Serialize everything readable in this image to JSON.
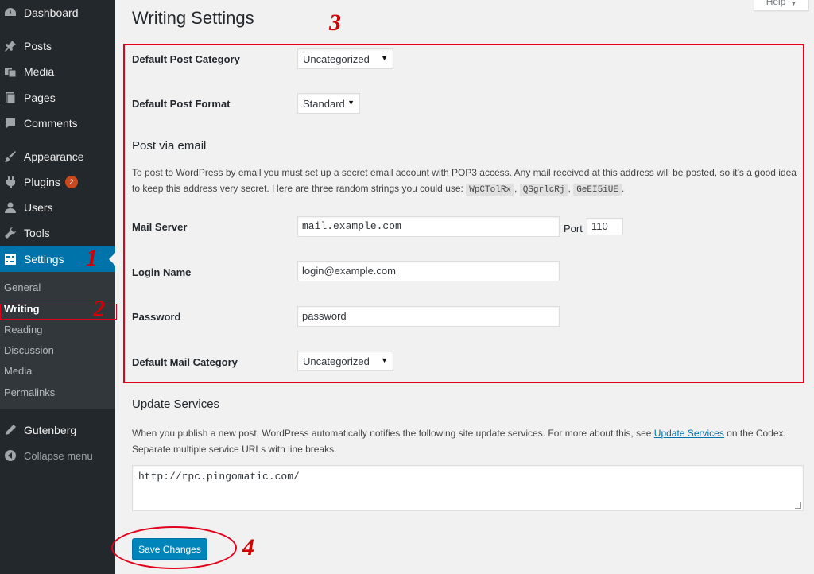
{
  "sidebar": {
    "items": [
      {
        "label": "Dashboard",
        "icon": "dashboard-icon"
      },
      {
        "label": "Posts",
        "icon": "pin-icon"
      },
      {
        "label": "Media",
        "icon": "media-icon"
      },
      {
        "label": "Pages",
        "icon": "pages-icon"
      },
      {
        "label": "Comments",
        "icon": "comment-icon"
      },
      {
        "label": "Appearance",
        "icon": "brush-icon"
      },
      {
        "label": "Plugins",
        "icon": "plugin-icon",
        "badge": "2"
      },
      {
        "label": "Users",
        "icon": "user-icon"
      },
      {
        "label": "Tools",
        "icon": "wrench-icon"
      },
      {
        "label": "Settings",
        "icon": "settings-icon"
      },
      {
        "label": "Gutenberg",
        "icon": "pencil-icon"
      },
      {
        "label": "Collapse menu",
        "icon": "collapse-icon"
      }
    ],
    "submenu": [
      "General",
      "Writing",
      "Reading",
      "Discussion",
      "Media",
      "Permalinks"
    ]
  },
  "header": {
    "title": "Writing Settings",
    "help": "Help"
  },
  "form": {
    "default_category_label": "Default Post Category",
    "default_category_value": "Uncategorized",
    "default_format_label": "Default Post Format",
    "default_format_value": "Standard",
    "post_via_email_heading": "Post via email",
    "post_via_email_desc_1": "To post to WordPress by email you must set up a secret email account with POP3 access. Any mail received at this address will be posted, so it’s a good idea",
    "post_via_email_desc_2": "to keep this address very secret. Here are three random strings you could use:",
    "random_strings": [
      "WpCTolRx",
      "QSgrlcRj",
      "GeEI5iUE"
    ],
    "mail_server_label": "Mail Server",
    "mail_server_value": "mail.example.com",
    "port_label": "Port",
    "port_value": "110",
    "login_name_label": "Login Name",
    "login_name_value": "login@example.com",
    "password_label": "Password",
    "password_value": "password",
    "default_mail_category_label": "Default Mail Category",
    "default_mail_category_value": "Uncategorized"
  },
  "update_services": {
    "heading": "Update Services",
    "desc_1": "When you publish a new post, WordPress automatically notifies the following site update services. For more about this, see",
    "link_text": "Update Services",
    "desc_1_end": "on the Codex.",
    "desc_2": "Separate multiple service URLs with line breaks.",
    "textarea_value": "http://rpc.pingomatic.com/"
  },
  "save_label": "Save Changes",
  "annotations": [
    "1",
    "2",
    "3",
    "4"
  ]
}
